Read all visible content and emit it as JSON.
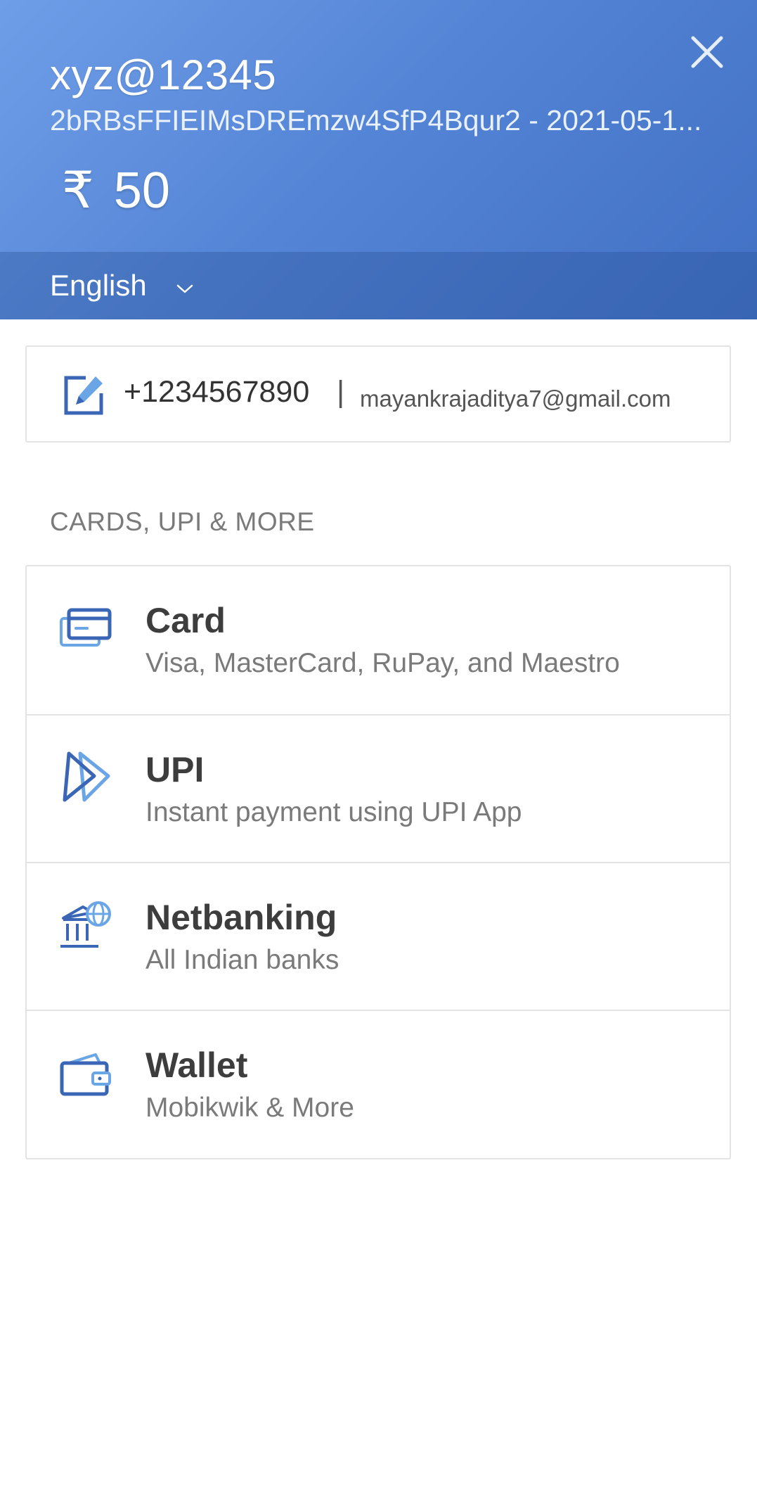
{
  "header": {
    "merchant": "xyz@12345",
    "description": "2bRBsFFIEIMsDREmzw4SfP4Bqur2 - 2021-05-1...",
    "currency_symbol": "₹",
    "amount": "50",
    "close_icon": "close-icon",
    "language": "English",
    "language_icon": "chevron-down-icon"
  },
  "contact": {
    "edit_icon": "edit-icon",
    "phone": "+1234567890",
    "separator": "|",
    "email": "mayankrajaditya7@gmail.com"
  },
  "section_title": "CARDS, UPI & MORE",
  "methods": [
    {
      "title": "Card",
      "subtitle": "Visa, MasterCard, RuPay, and Maestro",
      "icon": "card-icon"
    },
    {
      "title": "UPI",
      "subtitle": "Instant payment using UPI App",
      "icon": "upi-icon"
    },
    {
      "title": "Netbanking",
      "subtitle": "All Indian banks",
      "icon": "bank-icon"
    },
    {
      "title": "Wallet",
      "subtitle": "Mobikwik & More",
      "icon": "wallet-icon"
    }
  ],
  "colors": {
    "header_start": "#6f9ee8",
    "header_end": "#4170c4",
    "icon_dark": "#3a66b5",
    "icon_light": "#6aa5e6",
    "title_text": "#3d3d3d",
    "muted_text": "#7a7a7a"
  }
}
